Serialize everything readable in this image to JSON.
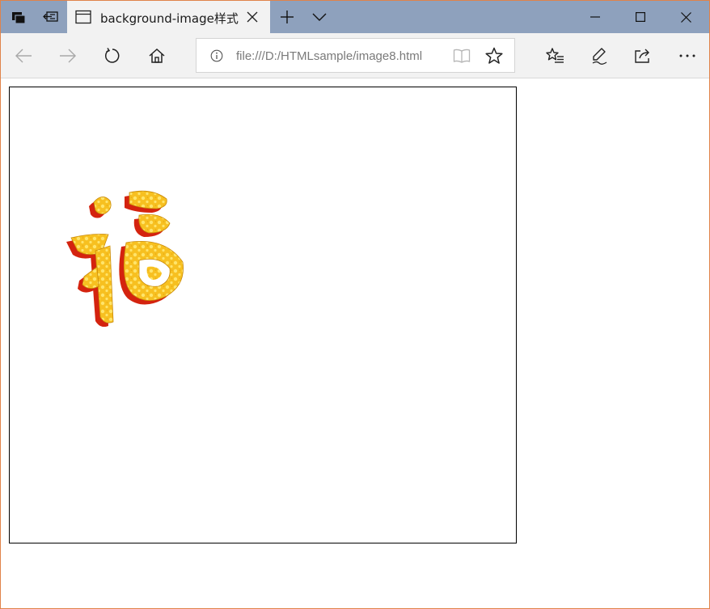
{
  "browser": {
    "tab": {
      "title": "background-image样式"
    },
    "address": {
      "url": "file:///D:/HTMLsample/image8.html"
    }
  },
  "page": {
    "image": {
      "description_icon": "fu-character-icon",
      "colors": {
        "gold": "#f7c020",
        "light_gold": "#ffe46a",
        "red_shadow": "#d4230f",
        "border": "#000000"
      }
    }
  },
  "theme": {
    "titlebar_bg": "#8ea1bd",
    "tab_bg": "#f2f2f2",
    "window_border": "#e0834a"
  }
}
